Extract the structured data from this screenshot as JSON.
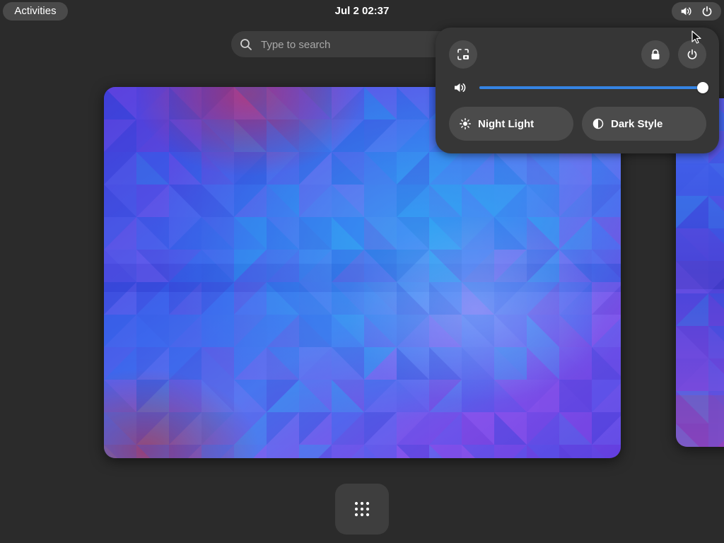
{
  "topbar": {
    "activities_label": "Activities",
    "clock": "Jul 2  02:37",
    "status_icons": [
      "volume-icon",
      "power-icon"
    ]
  },
  "search": {
    "placeholder": "Type to search"
  },
  "quick_settings": {
    "top_buttons": [
      "screenshot-icon",
      "lock-icon",
      "power-icon"
    ],
    "volume": {
      "icon": "volume-icon",
      "level": 1.0
    },
    "toggles": [
      {
        "label": "Night Light",
        "icon": "night-light-icon",
        "active": false
      },
      {
        "label": "Dark Style",
        "icon": "dark-style-icon",
        "active": false
      }
    ],
    "accent_color": "#3584e4"
  },
  "dash": {
    "app_grid_icon": "app-grid-icon"
  }
}
